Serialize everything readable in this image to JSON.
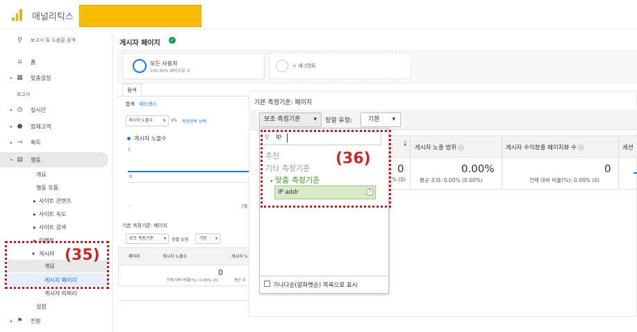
{
  "app": {
    "title": "애널리틱스"
  },
  "sidebar": {
    "search_placeholder": "보고서 및 도움말 검색",
    "items": [
      {
        "label": "홈",
        "icon": "home-icon"
      },
      {
        "label": "맞춤설정",
        "icon": "dashboard-icon"
      }
    ],
    "section_reports": "보고서",
    "report_items": [
      {
        "label": "실시간",
        "icon": "clock-icon"
      },
      {
        "label": "잠재고객",
        "icon": "person-icon"
      },
      {
        "label": "획득",
        "icon": "acquisition-icon"
      },
      {
        "label": "행동",
        "icon": "behavior-icon"
      }
    ],
    "behavior_children": [
      {
        "label": "개요"
      },
      {
        "label": "행동 흐름"
      },
      {
        "label": "사이트 콘텐츠"
      },
      {
        "label": "사이트 속도"
      },
      {
        "label": "사이트 검색"
      },
      {
        "label": "이벤트"
      },
      {
        "label": "게시자"
      }
    ],
    "publisher_children": [
      {
        "label": "개요"
      },
      {
        "label": "게시자 페이지"
      },
      {
        "label": "게시자 리퍼러"
      }
    ],
    "experiments": "실험",
    "conversions": {
      "label": "전환",
      "icon": "flag-icon"
    }
  },
  "main": {
    "page_title": "게시자 페이지",
    "segments": {
      "all_users": "모든 사용자",
      "all_users_sub": "100.00% 페이지뷰 수",
      "add_segment": "+ 세그먼트"
    },
    "tab": "탐색",
    "subtabs": {
      "summary": "합계",
      "adsense": "애드센스"
    },
    "metric_select": "게시자 노출수",
    "vs": "VS.",
    "choose_metric": "측정항목 선택",
    "legend": "게시자 노출수",
    "y_axis": {
      "top": "1",
      "bottom": "0"
    },
    "x_axis": {
      "start": "...",
      "label_7": "7월"
    },
    "bg_table": {
      "primary_dimension": "기본 측정기준: 페이지",
      "secondary_btn": "보조 측정기준",
      "sort_label": "정렬 유형:",
      "sort_value": "기본",
      "col_page": "페이지",
      "col_impressions": "게시자 노출수",
      "col_cov": "게시자 노",
      "zero": "0",
      "total_pct": "전체 대비 비율(%): 0.00% (0)",
      "avg": "평균 조"
    }
  },
  "zoom": {
    "primary_dimension": "기본 측정기준:  페이지",
    "secondary_btn": "보조 측정기준",
    "sort_label": "정렬 유형:",
    "sort_value": "기본",
    "columns": [
      {
        "label": "게시자 노출 범위"
      },
      {
        "label": "게시자 수익창출 페이지뷰 수"
      },
      {
        "label": "세션"
      }
    ],
    "values": {
      "impressions": "0",
      "coverage": "0.00%",
      "coverage_sub": "평균 조회: 0.00% (0.00%)",
      "pageviews": "0",
      "pageviews_sub": "전체 대비 비율(%): 0.00% (0)",
      "impressions_sub": "% (0)"
    },
    "dropdown": {
      "search_value": "ip",
      "recommended": "추천",
      "other": "기타 측정기준",
      "custom": "맞춤 측정기준",
      "custom_item": "IP addr",
      "alpha_checkbox": "가나다순(알파벳순) 목록으로 표시"
    }
  },
  "annotations": {
    "label_36": "(36)",
    "label_35": "(35)"
  },
  "colors": {
    "accent_blue": "#1a73e8",
    "highlight_yellow": "#fbbc04",
    "annotation_red": "#c62828",
    "green_item": "#d7ebc6"
  }
}
